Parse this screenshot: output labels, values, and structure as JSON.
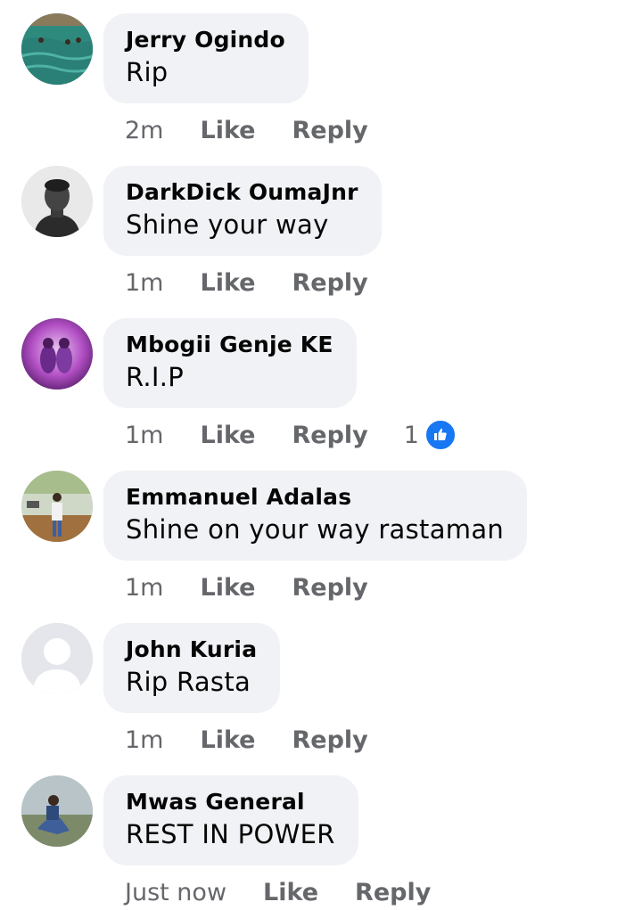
{
  "comments": [
    {
      "author": "Jerry Ogindo",
      "text": "Rip",
      "time": "2m",
      "like_label": "Like",
      "reply_label": "Reply"
    },
    {
      "author": "DarkDick OumaJnr",
      "text": "Shine your way",
      "time": "1m",
      "like_label": "Like",
      "reply_label": "Reply"
    },
    {
      "author": "Mbogii Genje KE",
      "text": "R.I.P",
      "time": "1m",
      "like_label": "Like",
      "reply_label": "Reply",
      "reaction_count": "1"
    },
    {
      "author": "Emmanuel Adalas",
      "text": "Shine on your way rastaman",
      "time": "1m",
      "like_label": "Like",
      "reply_label": "Reply"
    },
    {
      "author": "John Kuria",
      "text": "Rip Rasta",
      "time": "1m",
      "like_label": "Like",
      "reply_label": "Reply"
    },
    {
      "author": "Mwas General",
      "text": "REST IN POWER",
      "time": "Just now",
      "like_label": "Like",
      "reply_label": "Reply"
    }
  ],
  "colors": {
    "bubble": "#f0f2f5",
    "meta_text": "#65676b",
    "like_blue": "#1877f2"
  },
  "icons": {
    "reaction": "thumbs-up-icon"
  }
}
